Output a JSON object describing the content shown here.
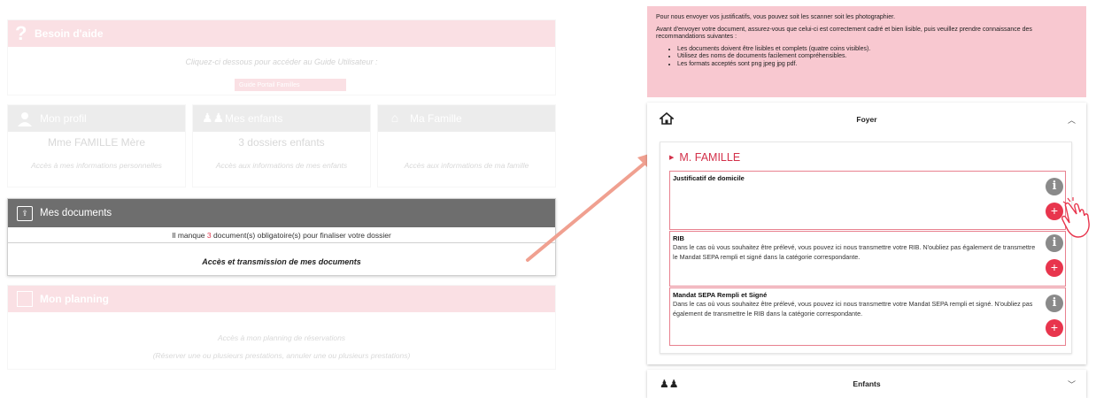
{
  "left": {
    "help": {
      "title": "Besoin d'aide",
      "subtitle": "Cliquez-ci dessous pour accéder au Guide Utilisateur :",
      "button": "Guide Portail Familles"
    },
    "tiles": [
      {
        "title": "Mon profil",
        "value": "Mme FAMILLE Mère",
        "link": "Accès à mes informations personnelles",
        "icon": "user-icon"
      },
      {
        "title": "Mes enfants",
        "value": "3 dossiers enfants",
        "link": "Accès aux informations de mes enfants",
        "icon": "children-icon"
      },
      {
        "title": "Ma Famille",
        "value": "",
        "link": "Accès aux informations de ma famille",
        "icon": "family-icon"
      }
    ],
    "documents": {
      "title": "Mes documents",
      "warning_prefix": "Il manque ",
      "warning_count": "3",
      "warning_suffix": " document(s) obligatoire(s) pour finaliser votre dossier",
      "link": "Accès et transmission de mes documents"
    },
    "planning": {
      "title": "Mon planning",
      "line1": "Accès à mon planning de réservations",
      "line2": "(Réserver une ou plusieurs prestations, annuler une ou plusieurs prestations)"
    }
  },
  "right": {
    "info": {
      "p1": "Pour nous envoyer vos justificatifs, vous pouvez soit les scanner soit les photographier.",
      "p2": "Avant d'envoyer votre document, assurez-vous que celui-ci est correctement cadré et bien lisible, puis veuillez prendre connaissance des recommandations suivantes :",
      "bullets": [
        "Les documents doivent être lisibles et complets (quatre coins visibles).",
        "Utilisez des noms de documents facilement compréhensibles.",
        "Les formats acceptés sont png jpeg jpg pdf."
      ]
    },
    "foyer": {
      "title": "Foyer",
      "person": "M. FAMILLE",
      "docs": [
        {
          "title": "Justificatif de domicile",
          "desc": ""
        },
        {
          "title": "RIB",
          "desc": "Dans le cas où vous souhaitez être prélevé, vous pouvez ici nous transmettre votre RIB. N'oubliez pas également de transmettre le Mandat SEPA rempli et signé dans la catégorie correspondante."
        },
        {
          "title": "Mandat SEPA Rempli et Signé",
          "desc": "Dans le cas où vous souhaitez être prélevé, vous pouvez ici nous transmettre votre Mandat SEPA rempli et signé. N'oubliez pas également de transmettre le RIB dans la catégorie correspondante."
        }
      ]
    },
    "enfants": {
      "title": "Enfants"
    }
  },
  "colors": {
    "pink": "#f0a0ad",
    "red": "#e8354d",
    "dark_header": "#6e6e6e",
    "info_bg": "#f8c8d0",
    "arrow": "#f0a090"
  }
}
